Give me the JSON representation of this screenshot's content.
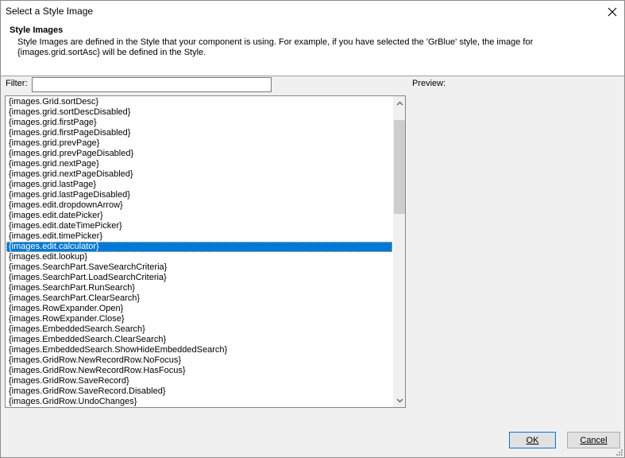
{
  "window": {
    "title": "Select a Style Image"
  },
  "header": {
    "title": "Style Images",
    "description": "Style Images are defined in the Style that your component is using. For example, if you have selected the 'GrBlue' style, the image for {images.grid.sortAsc} will be defined in the Style."
  },
  "filter": {
    "label": "Filter:",
    "value": ""
  },
  "preview": {
    "label": "Preview:"
  },
  "list": {
    "selected_index": 14,
    "items": [
      "{images.Grid.sortDesc}",
      "{images.grid.sortDescDisabled}",
      "{images.grid.firstPage}",
      "{images.grid.firstPageDisabled}",
      "{images.grid.prevPage}",
      "{images.grid.prevPageDisabled}",
      "{images.grid.nextPage}",
      "{images.grid.nextPageDisabled}",
      "{images.grid.lastPage}",
      "{images.grid.lastPageDisabled}",
      "{images.edit.dropdownArrow}",
      "{images.edit.datePicker}",
      "{images.edit.dateTimePicker}",
      "{images.edit.timePicker}",
      "{images.edit.calculator}",
      "{images.edit.lookup}",
      "{images.SearchPart.SaveSearchCriteria}",
      "{images.SearchPart.LoadSearchCriteria}",
      "{images.SearchPart.RunSearch}",
      "{images.SearchPart.ClearSearch}",
      "{images.RowExpander.Open}",
      "{images.RowExpander.Close}",
      "{images.EmbeddedSearch.Search}",
      "{images.EmbeddedSearch.ClearSearch}",
      "{images.EmbeddedSearch.ShowHideEmbeddedSearch}",
      "{images.GridRow.NewRecordRow.NoFocus}",
      "{images.GridRow.NewRecordRow.HasFocus}",
      "{images.GridRow.SaveRecord}",
      "{images.GridRow.SaveRecord.Disabled}",
      "{images.GridRow.UndoChanges}"
    ]
  },
  "buttons": {
    "ok": "OK",
    "cancel": "Cancel"
  },
  "colors": {
    "selection": "#0078d7",
    "background": "#f0f0f0"
  },
  "icons": {
    "close": "close-icon",
    "scroll_up": "chevron-up-icon",
    "scroll_down": "chevron-down-icon"
  }
}
